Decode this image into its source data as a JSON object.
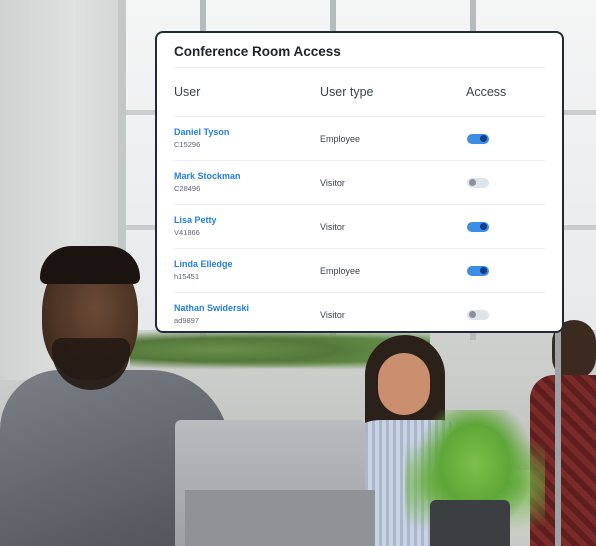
{
  "card": {
    "title": "Conference Room Access",
    "columns": {
      "user": "User",
      "user_type": "User type",
      "access": "Access"
    },
    "rows": [
      {
        "name": "Daniel Tyson",
        "id": "C15296",
        "type": "Employee",
        "access": true
      },
      {
        "name": "Mark Stockman",
        "id": "C28496",
        "type": "Visitor",
        "access": false
      },
      {
        "name": "Lisa Petty",
        "id": "V41866",
        "type": "Visitor",
        "access": true
      },
      {
        "name": "Linda Elledge",
        "id": "h15451",
        "type": "Employee",
        "access": true
      },
      {
        "name": "Nathan Swiderski",
        "id": "ad9897",
        "type": "Visitor",
        "access": false
      }
    ]
  },
  "colors": {
    "accent": "#2280e2",
    "toggle_on": "#3b8de6",
    "toggle_off": "#dfe3ea",
    "card_border": "#1f2a3c"
  }
}
